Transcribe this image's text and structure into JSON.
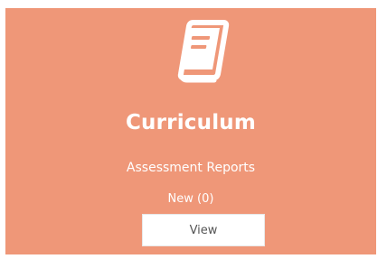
{
  "card": {
    "icon": "book-icon",
    "title": "Curriculum",
    "subtitle": "Assessment Reports",
    "count_label": "New (0)",
    "button_label": "View",
    "colors": {
      "background": "#ef9778",
      "text": "#ffffff",
      "button_background": "#ffffff",
      "button_text": "#555555"
    }
  }
}
